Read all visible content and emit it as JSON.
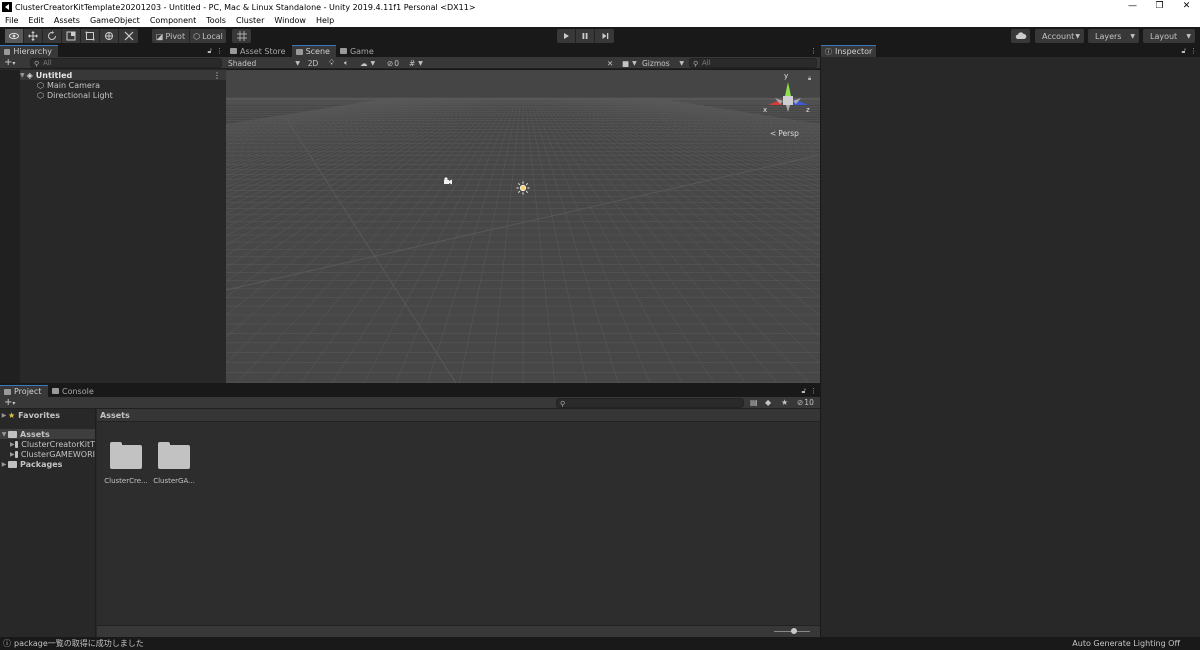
{
  "window": {
    "title": "ClusterCreatorKitTemplate20201203 - Untitled - PC, Mac & Linux Standalone - Unity 2019.4.11f1 Personal <DX11>",
    "minimize": "—",
    "maximize": "❐",
    "close": "✕"
  },
  "menu": [
    "File",
    "Edit",
    "Assets",
    "GameObject",
    "Component",
    "Tools",
    "Cluster",
    "Window",
    "Help"
  ],
  "toolbar": {
    "pivot": "Pivot",
    "local": "Local",
    "account": "Account",
    "layers": "Layers",
    "layout": "Layout"
  },
  "hierarchy": {
    "tab": "Hierarchy",
    "search_placeholder": "All",
    "scene": "Untitled",
    "items": [
      "Main Camera",
      "Directional Light"
    ]
  },
  "scene": {
    "tabs": [
      "Asset Store",
      "Scene",
      "Game"
    ],
    "shading": "Shaded",
    "mode_2d": "2D",
    "hidden_count": "0",
    "gizmos": "Gizmos",
    "search_placeholder": "All",
    "persp": "Persp",
    "axis_y": "y",
    "axis_x": "x",
    "axis_z": "z"
  },
  "inspector": {
    "tab": "Inspector"
  },
  "project": {
    "tabs": [
      "Project",
      "Console"
    ],
    "hidden_count": "10",
    "tree": {
      "favorites": "Favorites",
      "assets": "Assets",
      "asset_children": [
        "ClusterCreatorKitT",
        "ClusterGAMEWORI"
      ],
      "packages": "Packages"
    },
    "breadcrumb": "Assets",
    "assets": [
      "ClusterCre...",
      "ClusterGA..."
    ]
  },
  "status": {
    "message": "package一覧の取得に成功しました",
    "right": "Auto Generate Lighting Off"
  },
  "colors": {
    "accent": "#3a79bb",
    "scene_bg": "#474747",
    "panel_bg": "#282828"
  }
}
